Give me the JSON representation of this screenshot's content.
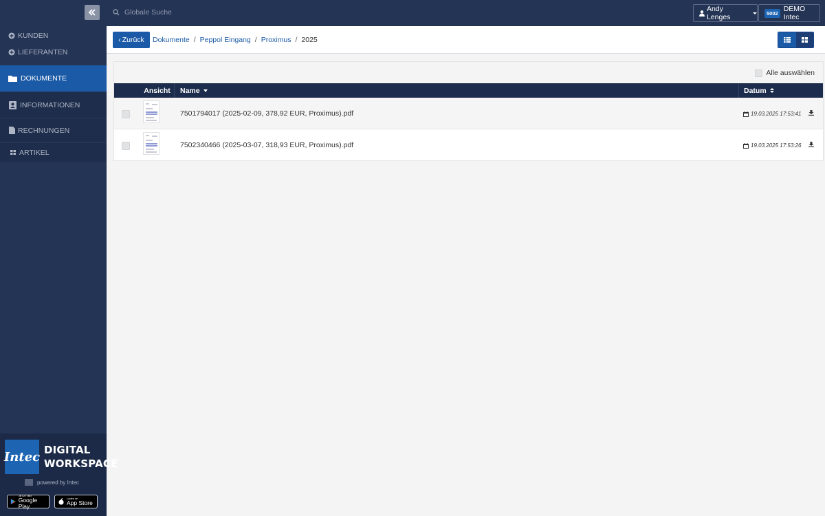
{
  "search": {
    "placeholder": "Globale Suche"
  },
  "user": {
    "name": "Andy Lenges"
  },
  "org": {
    "badge": "5002",
    "name": "DEMO Intec"
  },
  "sidebar": {
    "items": [
      {
        "label": "KUNDEN",
        "icon": "plus-circle-icon"
      },
      {
        "label": "LIEFERANTEN",
        "icon": "plus-circle-icon"
      },
      {
        "label": "DOKUMENTE",
        "icon": "folder-icon"
      },
      {
        "label": "INFORMATIONEN",
        "icon": "contact-book-icon"
      },
      {
        "label": "RECHNUNGEN",
        "icon": "file-icon"
      },
      {
        "label": "ARTIKEL",
        "icon": "grid-icon"
      }
    ]
  },
  "brand": {
    "logo_text": "Intec",
    "line1": "DIGITAL",
    "line2": "WORKSPACE",
    "powered": "powered by Intec",
    "google_small": "JETZT BEI",
    "google_big": "Google Play",
    "apple_small": "Laden im",
    "apple_big": "App Store"
  },
  "breadcrumb": {
    "back": "Zurück",
    "items": [
      "Dokumente",
      "Peppol Eingang",
      "Proximus",
      "2025"
    ],
    "sep": "/"
  },
  "table": {
    "select_all": "Alle auswählen",
    "columns": {
      "view": "Ansicht",
      "name": "Name",
      "date": "Datum"
    },
    "rows": [
      {
        "name": "7501794017 (2025-02-09, 378,92 EUR, Proximus).pdf",
        "date": "19.03.2025 17:53:41"
      },
      {
        "name": "7502340466 (2025-03-07, 318,93 EUR, Proximus).pdf",
        "date": "19.03.2025 17:53:26"
      }
    ]
  },
  "colors": {
    "navy": "#243455",
    "accent": "#1b5aa6",
    "table_head": "#1c2c4c"
  }
}
